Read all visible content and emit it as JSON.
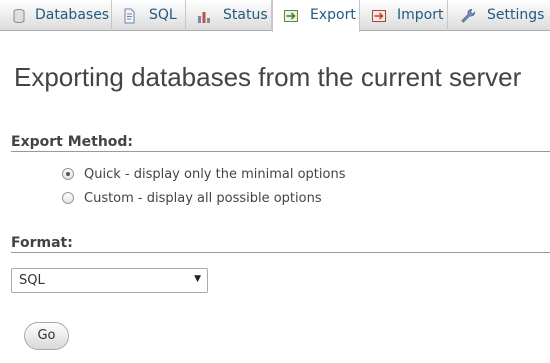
{
  "tabs": [
    {
      "label": "Databases",
      "icon": "database-icon"
    },
    {
      "label": "SQL",
      "icon": "sql-document-icon"
    },
    {
      "label": "Status",
      "icon": "status-chart-icon"
    },
    {
      "label": "Export",
      "icon": "export-icon",
      "active": true
    },
    {
      "label": "Import",
      "icon": "import-icon"
    },
    {
      "label": "Settings",
      "icon": "wrench-icon"
    }
  ],
  "page": {
    "title": "Exporting databases from the current server"
  },
  "export_method": {
    "heading": "Export Method:",
    "options": [
      {
        "label": "Quick - display only the minimal options",
        "checked": true
      },
      {
        "label": "Custom - display all possible options",
        "checked": false
      }
    ]
  },
  "format": {
    "heading": "Format:",
    "selected": "SQL"
  },
  "go_button": {
    "label": "Go"
  },
  "colors": {
    "tab_text": "#235a81",
    "text": "#444444",
    "rule": "#999999"
  }
}
